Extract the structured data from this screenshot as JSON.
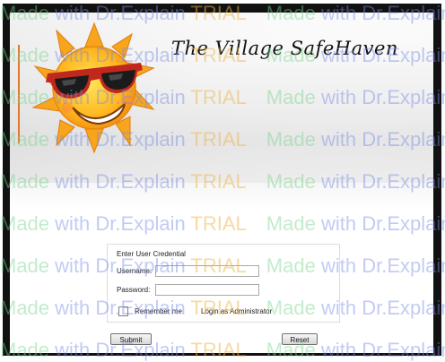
{
  "app": {
    "title": "The Village SafeHaven",
    "logo_icon": "sun-with-sunglasses-icon"
  },
  "login": {
    "section_title": "Enter User Credential",
    "username_label": "Username:",
    "username_value": "",
    "password_label": "Password:",
    "password_value": "",
    "remember_label": "Remember me",
    "remember_checked": false,
    "admin_label": "Login as Administrator",
    "submit_label": "Submit",
    "reset_label": "Reset"
  },
  "watermark": {
    "made": "Made",
    "with": "with",
    "dr_explain": "Dr.Explain",
    "trial": "TRIAL"
  },
  "colors": {
    "accent_rule": "#e07a2a",
    "frame": "#111111"
  }
}
